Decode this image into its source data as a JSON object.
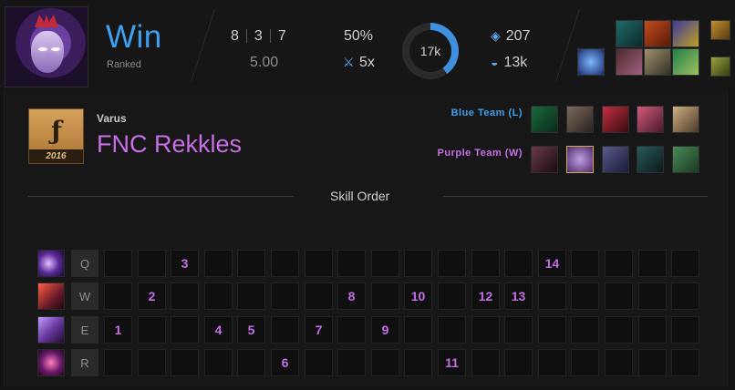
{
  "match": {
    "result": "Win",
    "queue": "Ranked",
    "kills": "8",
    "deaths": "3",
    "assists": "7",
    "kda_ratio": "5.00",
    "kill_participation": "50%",
    "multikill": "5x",
    "ring_value": "17k",
    "gold": "207",
    "cs": "13k"
  },
  "player": {
    "champion": "Varus",
    "name": "FNC Rekkles",
    "team_logo_year": "2016"
  },
  "teams": {
    "blue_label": "Blue Team (L)",
    "purple_label": "Purple Team (W)"
  },
  "skill_order": {
    "title": "Skill Order",
    "rows": [
      {
        "key": "Q",
        "cells": [
          "",
          "",
          "3",
          "",
          "",
          "",
          "",
          "",
          "",
          "",
          "",
          "",
          "",
          "14",
          "",
          "",
          "",
          ""
        ]
      },
      {
        "key": "W",
        "cells": [
          "",
          "2",
          "",
          "",
          "",
          "",
          "",
          "8",
          "",
          "10",
          "",
          "12",
          "13",
          "",
          "",
          "",
          "",
          ""
        ]
      },
      {
        "key": "E",
        "cells": [
          "1",
          "",
          "",
          "4",
          "5",
          "",
          "7",
          "",
          "9",
          "",
          "",
          "",
          "",
          "",
          "",
          "",
          "",
          ""
        ]
      },
      {
        "key": "R",
        "cells": [
          "",
          "",
          "",
          "",
          "",
          "6",
          "",
          "",
          "",
          "",
          "11",
          "",
          "",
          "",
          "",
          "",
          "",
          ""
        ]
      }
    ]
  },
  "colors": {
    "win": "#3ea1ef",
    "purple": "#c86ee6",
    "accent": "#3e8fdd"
  },
  "icons": {
    "multikill": "crossed-swords-icon",
    "gold": "gold-drop-icon",
    "cs": "minion-icon"
  }
}
